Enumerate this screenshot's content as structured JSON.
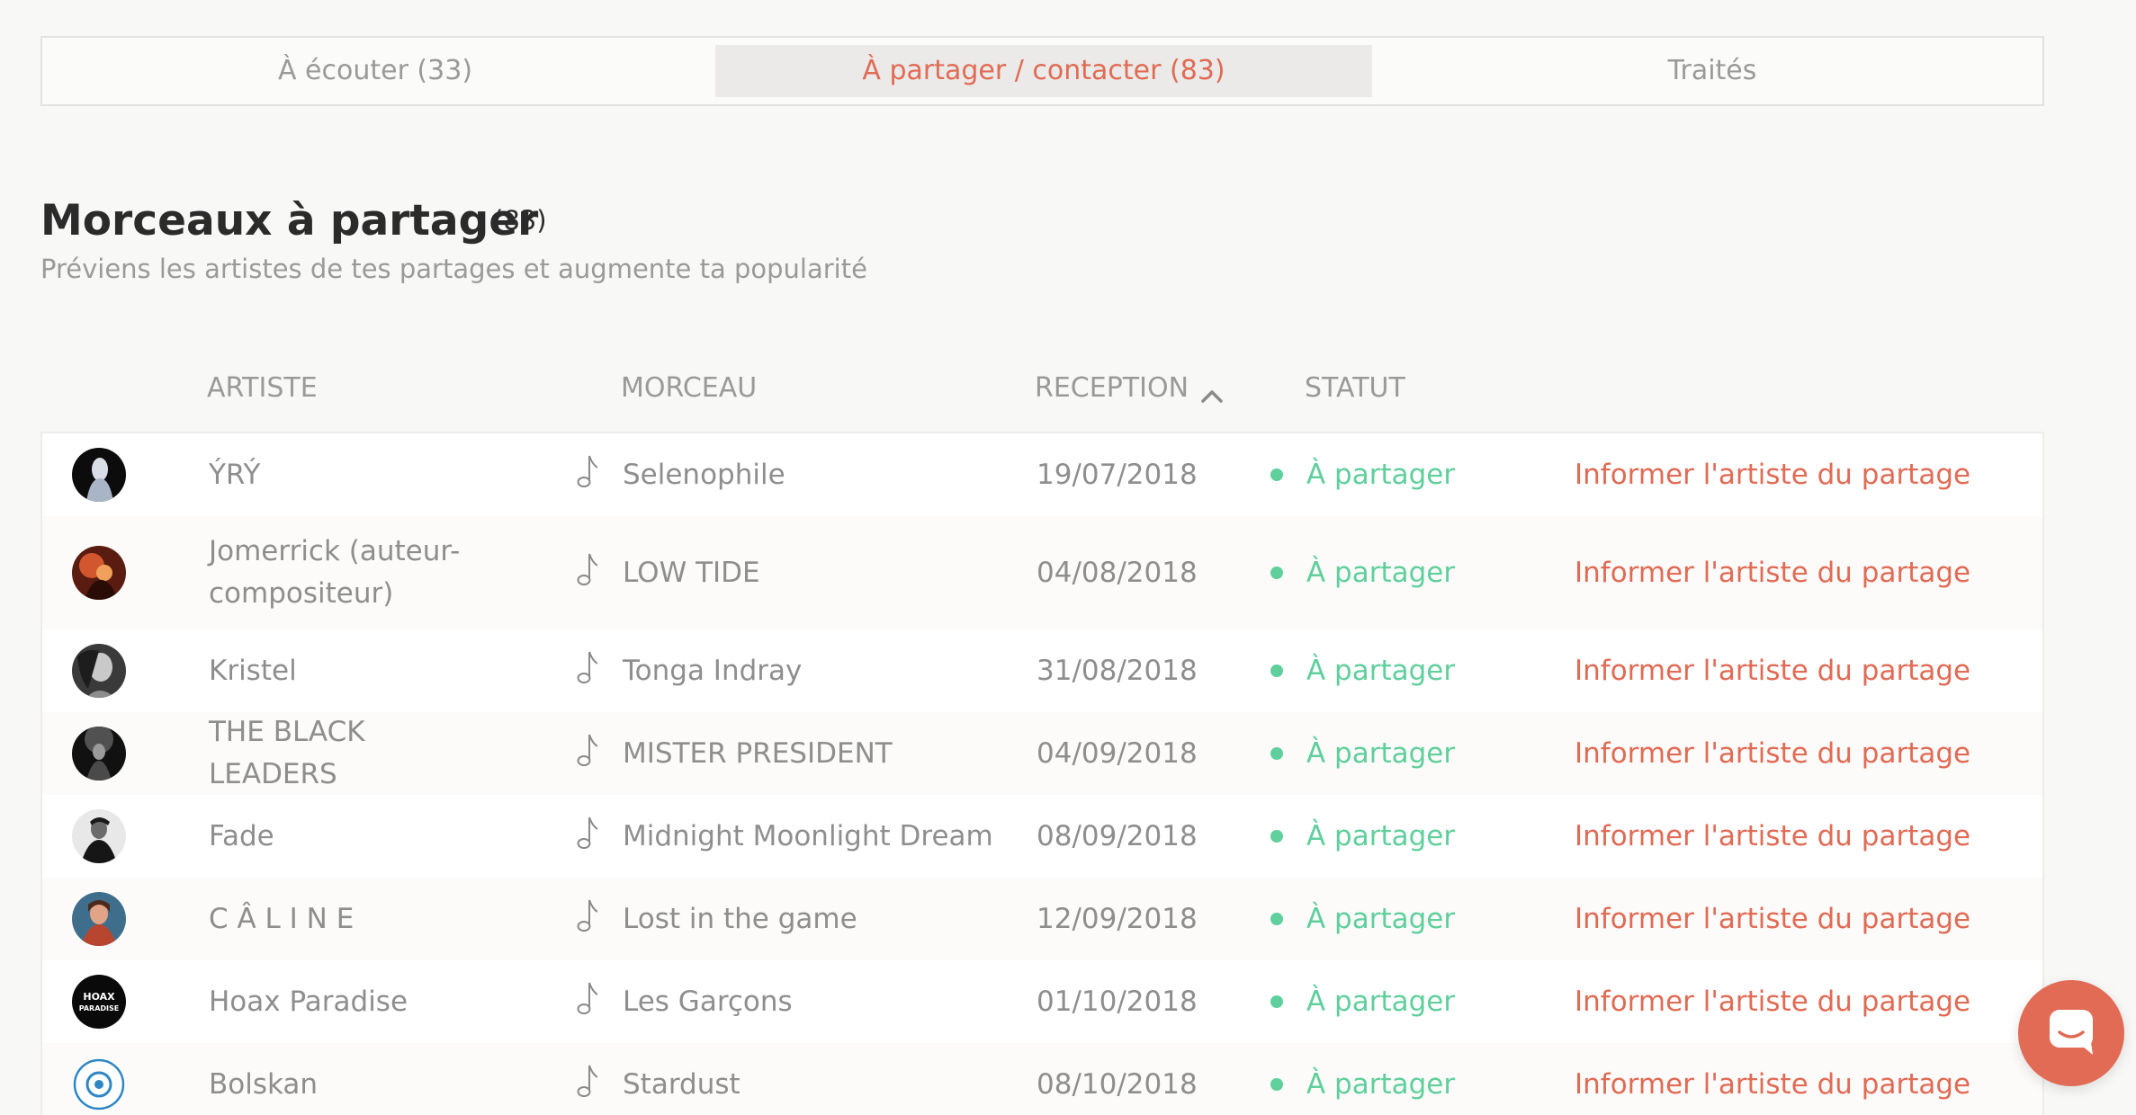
{
  "tabs": [
    {
      "label": "À écouter (33)"
    },
    {
      "label": "À partager / contacter (83)"
    },
    {
      "label": "Traités"
    }
  ],
  "section": {
    "title": "Morceaux à partager",
    "count": "(83)",
    "subtitle": "Préviens les artistes de tes partages et augmente ta popularité"
  },
  "columns": {
    "artist": "ARTISTE",
    "track": "MORCEAU",
    "reception": "RECEPTION",
    "status": "STATUT"
  },
  "rows": [
    {
      "artist": "ÝRÝ",
      "track": "Selenophile",
      "date": "19/07/2018",
      "status": "À partager",
      "action": "Informer l'artiste du partage"
    },
    {
      "artist": "Jomerrick (auteur-compositeur)",
      "track": "LOW TIDE",
      "date": "04/08/2018",
      "status": "À partager",
      "action": "Informer l'artiste du partage"
    },
    {
      "artist": "Kristel",
      "track": "Tonga Indray",
      "date": "31/08/2018",
      "status": "À partager",
      "action": "Informer l'artiste du partage"
    },
    {
      "artist": "THE BLACK LEADERS",
      "track": "MISTER PRESIDENT",
      "date": "04/09/2018",
      "status": "À partager",
      "action": "Informer l'artiste du partage"
    },
    {
      "artist": "Fade",
      "track": "Midnight Moonlight Dream",
      "date": "08/09/2018",
      "status": "À partager",
      "action": "Informer l'artiste du partage"
    },
    {
      "artist": "C Â L I N E",
      "track": "Lost in the game",
      "date": "12/09/2018",
      "status": "À partager",
      "action": "Informer l'artiste du partage"
    },
    {
      "artist": "Hoax Paradise",
      "track": "Les Garçons",
      "date": "01/10/2018",
      "status": "À partager",
      "action": "Informer l'artiste du partage",
      "avatar_text": [
        "HOAX",
        "PARADISE"
      ]
    },
    {
      "artist": "Bolskan",
      "track": "Stardust",
      "date": "08/10/2018",
      "status": "À partager",
      "action": "Informer l'artiste du partage"
    }
  ],
  "colors": {
    "accent": "#e16b55",
    "status_green": "#5fcf9c",
    "title": "#2b2b2b",
    "muted": "#9a9a9a"
  },
  "icons": {
    "sort": "chevron-up-icon",
    "track": "music-note-icon",
    "status": "status-dot-icon",
    "chat": "chat-bubble-icon"
  }
}
